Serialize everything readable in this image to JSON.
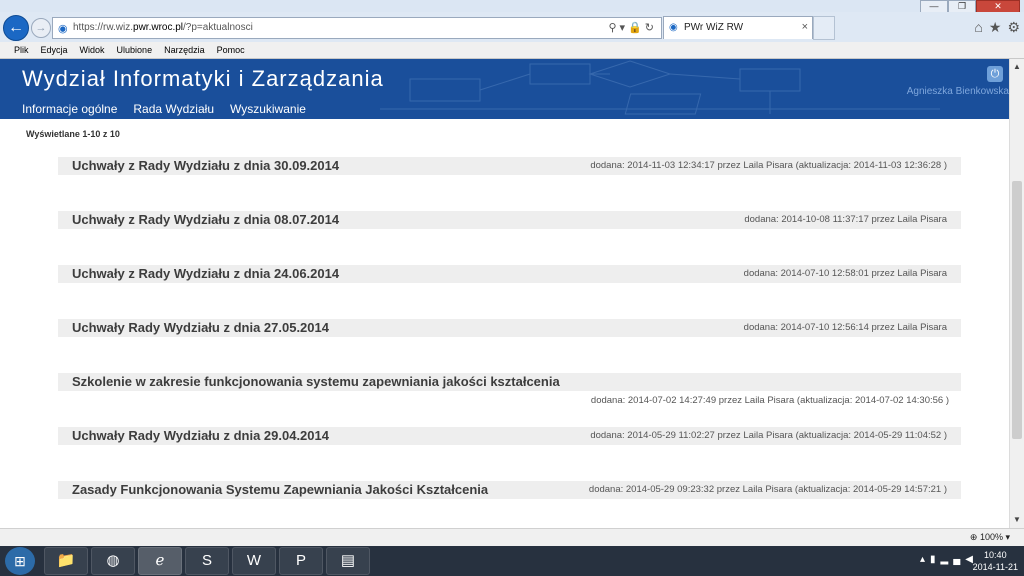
{
  "browser": {
    "window_buttons": [
      "—",
      "❐",
      "✕"
    ],
    "url_prefix": "https://rw.wiz.",
    "url_domain": "pwr.wroc.pl",
    "url_path": "/?p=aktualnosci",
    "tab_title": "PWr WiZ RW",
    "menu": [
      "Plik",
      "Edycja",
      "Widok",
      "Ulubione",
      "Narzędzia",
      "Pomoc"
    ],
    "zoom": "100%",
    "icons": [
      "back-arrow-icon",
      "forward-arrow-icon",
      "search-icon",
      "lock-icon",
      "refresh-icon",
      "home-icon",
      "star-icon",
      "gear-icon"
    ]
  },
  "site": {
    "title": "Wydział Informatyki i Zarządzania",
    "nav": [
      "Informacje ogólne",
      "Rada Wydziału",
      "Wyszukiwanie"
    ],
    "user": "Agnieszka Bienkowska",
    "colors": {
      "header": "#1a4f9b",
      "item_bg": "#eeeeee"
    }
  },
  "list": {
    "count_label": "Wyświetlane 1-10 z 10",
    "items": [
      {
        "title": "Uchwały z Rady Wydziału z dnia 30.09.2014",
        "meta": "dodana: 2014-11-03 12:34:17 przez Laila Pisara (aktualizacja: 2014-11-03 12:36:28 )"
      },
      {
        "title": "Uchwały z Rady Wydziału z dnia 08.07.2014",
        "meta": "dodana: 2014-10-08 11:37:17 przez Laila Pisara"
      },
      {
        "title": "Uchwały z Rady Wydziału z dnia 24.06.2014",
        "meta": "dodana: 2014-07-10 12:58:01 przez Laila Pisara"
      },
      {
        "title": "Uchwały Rady Wydziału z dnia 27.05.2014",
        "meta": "dodana: 2014-07-10 12:56:14 przez Laila Pisara"
      },
      {
        "title": "Szkolenie w zakresie funkcjonowania systemu zapewniania jakości kształcenia",
        "meta": "dodana: 2014-07-02 14:27:49 przez Laila Pisara (aktualizacja: 2014-07-02 14:30:56 )"
      },
      {
        "title": "Uchwały Rady Wydziału z dnia 29.04.2014",
        "meta": "dodana: 2014-05-29 11:02:27 przez Laila Pisara (aktualizacja: 2014-05-29 11:04:52 )"
      },
      {
        "title": "Zasady Funkcjonowania Systemu Zapewniania Jakości Kształcenia",
        "meta": "dodana: 2014-05-29 09:23:32 przez Laila Pisara (aktualizacja: 2014-05-29 14:57:21 )"
      }
    ]
  },
  "taskbar": {
    "apps": [
      "windows-start-icon",
      "file-explorer-icon",
      "firefox-icon",
      "internet-explorer-icon",
      "skype-icon",
      "word-icon",
      "powerpoint-icon",
      "pdf-icon"
    ],
    "time": "10:40",
    "date": "2014-11-21"
  }
}
